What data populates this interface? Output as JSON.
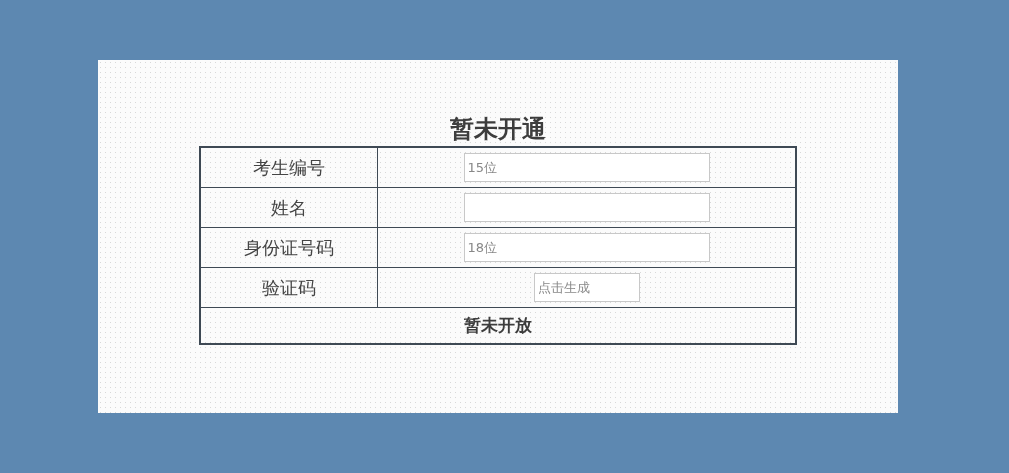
{
  "form": {
    "title": "暂未开通",
    "rows": [
      {
        "label": "考生编号",
        "field": {
          "kind": "text",
          "placeholder": "15位"
        }
      },
      {
        "label": "姓名",
        "field": {
          "kind": "text"
        }
      },
      {
        "label": "身份证号码",
        "field": {
          "kind": "text",
          "placeholder": "18位"
        }
      },
      {
        "label": "验证码",
        "field": {
          "kind": "captcha",
          "placeholder": "点击生成"
        }
      }
    ],
    "footer": "暂未开放"
  }
}
